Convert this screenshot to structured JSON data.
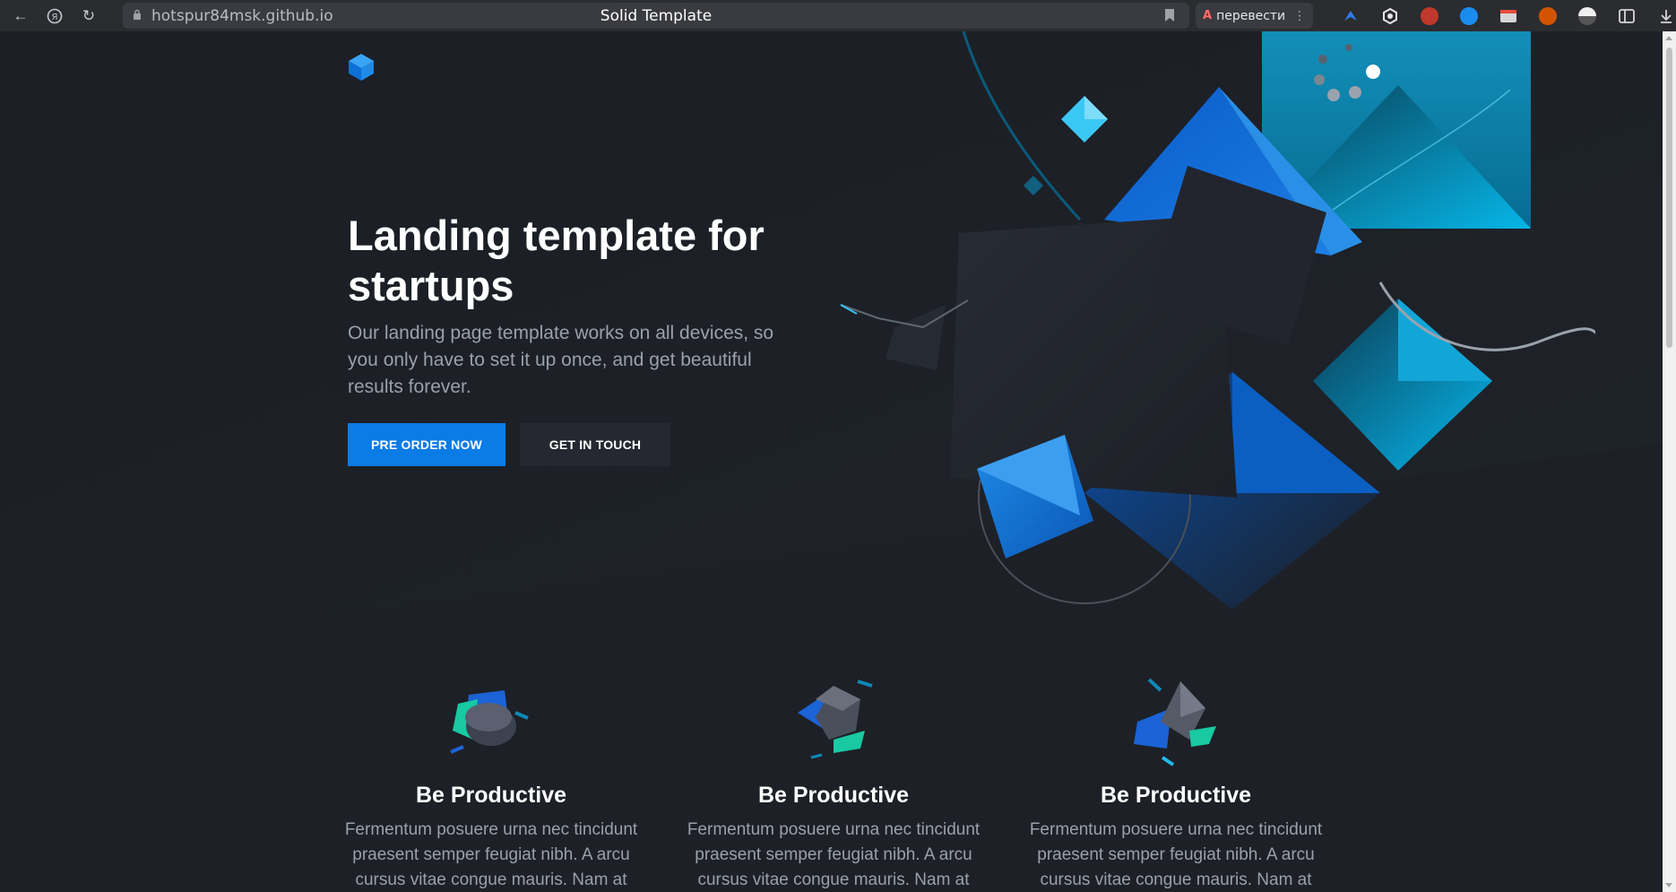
{
  "browser": {
    "url": "hotspur84msk.github.io",
    "tab_title": "Solid Template",
    "translate_label": "перевести"
  },
  "hero": {
    "title": "Landing template for startups",
    "text": "Our landing page template works on all devices, so you only have to set it up once, and get beautiful results forever.",
    "primary_button": "PRE ORDER NOW",
    "secondary_button": "GET IN TOUCH"
  },
  "features": [
    {
      "title": "Be Productive",
      "text": "Fermentum posuere urna nec tincidunt praesent semper feugiat nibh. A arcu cursus vitae congue mauris. Nam at"
    },
    {
      "title": "Be Productive",
      "text": "Fermentum posuere urna nec tincidunt praesent semper feugiat nibh. A arcu cursus vitae congue mauris. Nam at"
    },
    {
      "title": "Be Productive",
      "text": "Fermentum posuere urna nec tincidunt praesent semper feugiat nibh. A arcu cursus vitae congue mauris. Nam at"
    }
  ],
  "colors": {
    "background": "#1d2026",
    "accent": "#0b7be6",
    "secondary_button": "#252830",
    "text_muted": "#9aa0ab"
  }
}
